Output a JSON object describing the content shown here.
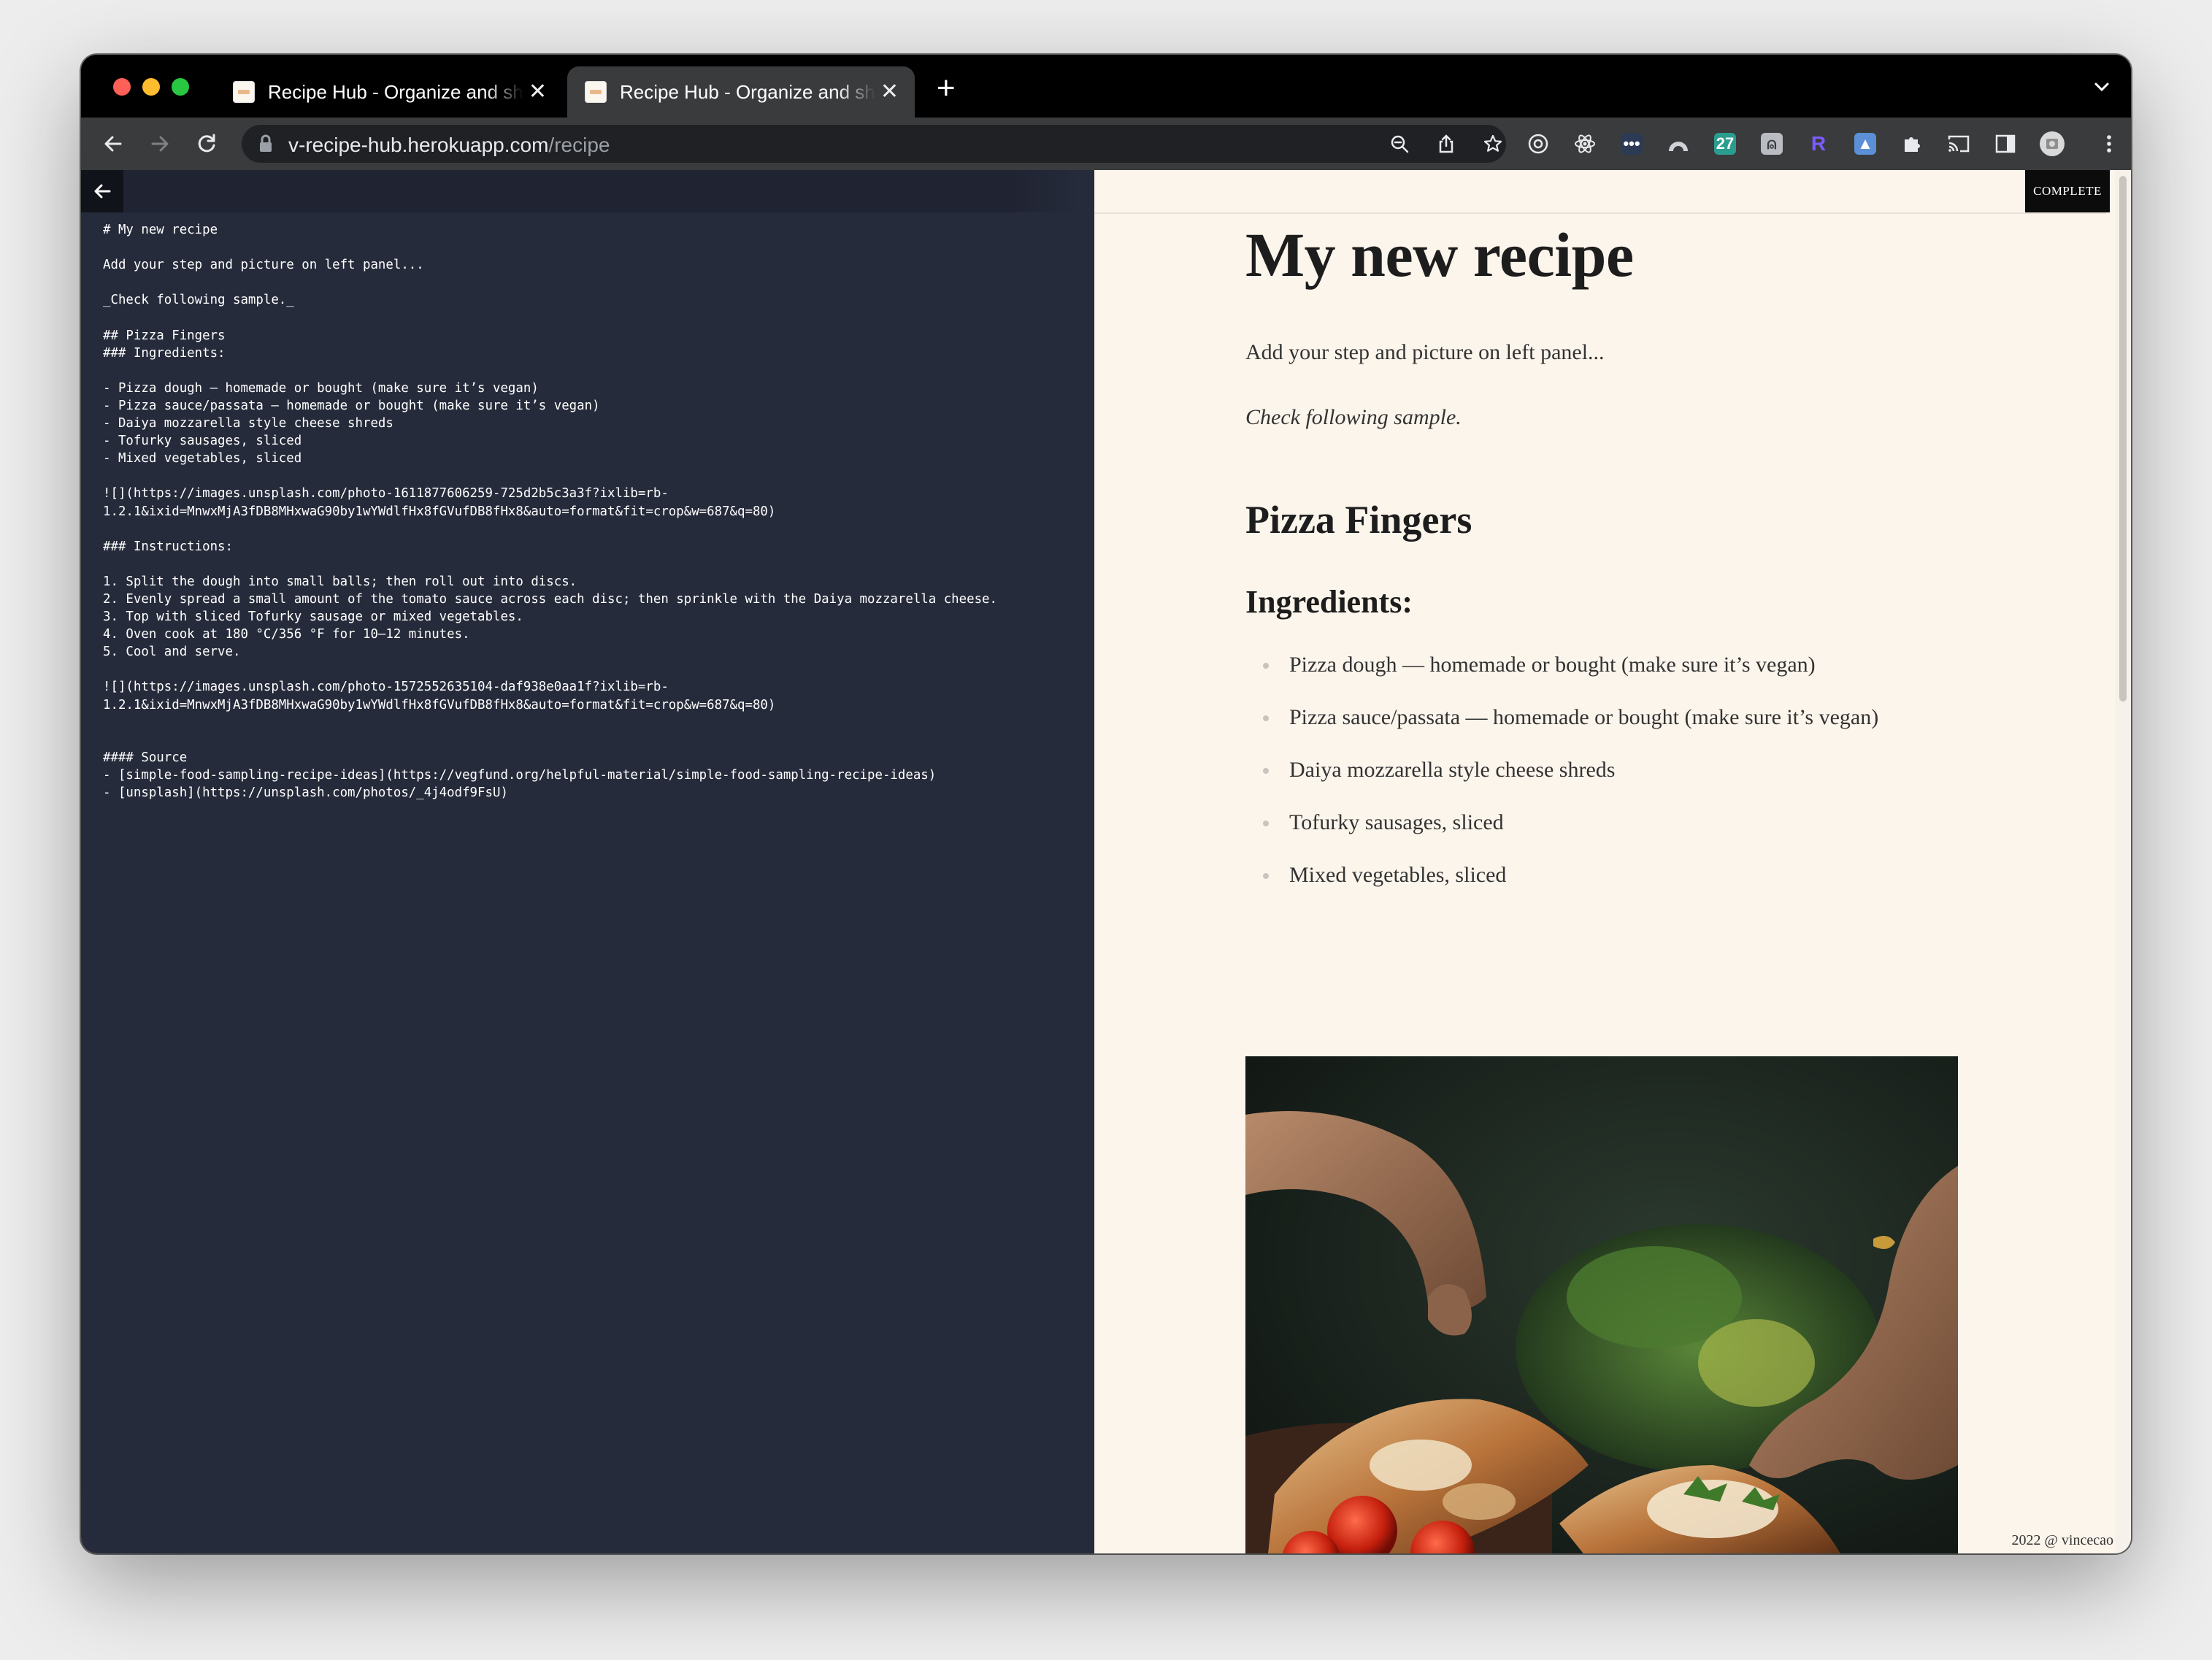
{
  "browser": {
    "tabs": [
      {
        "title": "Recipe Hub - Organize and share your recipes"
      },
      {
        "title": "Recipe Hub - Organize and share your recipes"
      }
    ],
    "url_host": "v-recipe-hub.herokuapp.com",
    "url_path": "/recipe",
    "extensions": [
      "openai-icon",
      "react-devtools-icon",
      "more-ext-icon",
      "arc-icon",
      "calendar-27-icon",
      "translate-icon",
      "r-icon",
      "screenshot-icon",
      "puzzle-icon",
      "cast-icon",
      "sidepanel-icon",
      "profile-avatar"
    ],
    "calendar_ext_label": "27",
    "r_ext_label": "R"
  },
  "editor": {
    "markdown": "# My new recipe\n\nAdd your step and picture on left panel...\n\n_Check following sample._\n\n## Pizza Fingers\n### Ingredients:\n\n- Pizza dough – homemade or bought (make sure it’s vegan)\n- Pizza sauce/passata – homemade or bought (make sure it’s vegan)\n- Daiya mozzarella style cheese shreds\n- Tofurky sausages, sliced\n- Mixed vegetables, sliced\n\n![](https://images.unsplash.com/photo-1611877606259-725d2b5c3a3f?ixlib=rb-\n1.2.1&ixid=MnwxMjA3fDB8MHxwaG90by1wYWdlfHx8fGVufDB8fHx8&auto=format&fit=crop&w=687&q=80)\n\n### Instructions:\n\n1. Split the dough into small balls; then roll out into discs.\n2. Evenly spread a small amount of the tomato sauce across each disc; then sprinkle with the Daiya mozzarella cheese.\n3. Top with sliced Tofurky sausage or mixed vegetables.\n4. Oven cook at 180 °C/356 °F for 10–12 minutes.\n5. Cool and serve.\n\n![](https://images.unsplash.com/photo-1572552635104-daf938e0aa1f?ixlib=rb-\n1.2.1&ixid=MnwxMjA3fDB8MHxwaG90by1wYWdlfHx8fGVufDB8fHx8&auto=format&fit=crop&w=687&q=80)\n\n\n#### Source\n- [simple-food-sampling-recipe-ideas](https://vegfund.org/helpful-material/simple-food-sampling-recipe-ideas)\n- [unsplash](https://unsplash.com/photos/_4j4odf9FsU)"
  },
  "preview": {
    "complete_label": "COMPLETE",
    "title": "My new recipe",
    "intro": "Add your step and picture on left panel...",
    "hint": "Check following sample.",
    "recipe_name": "Pizza Fingers",
    "ingredients_heading": "Ingredients:",
    "ingredients": [
      "Pizza dough — homemade or bought (make sure it’s vegan)",
      "Pizza sauce/passata — homemade or bought (make sure it’s vegan)",
      "Daiya mozzarella style cheese shreds",
      "Tofurky sausages, sliced",
      "Mixed vegetables, sliced"
    ],
    "footer": "2022 @ vincecao"
  },
  "colors": {
    "editor_bg": "#262b3b",
    "preview_bg": "#fcf5ec",
    "browser_chrome": "#3a3b3d"
  }
}
